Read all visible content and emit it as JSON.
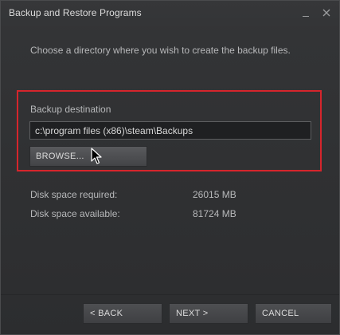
{
  "window": {
    "title": "Backup and Restore Programs"
  },
  "titlebar_buttons": {
    "minimize_icon": "minimize-icon",
    "close_icon": "close-icon"
  },
  "instruction": "Choose a directory where you wish to create the backup files.",
  "destination": {
    "label": "Backup destination",
    "value": "c:\\program files (x86)\\steam\\Backups",
    "browse_label": "BROWSE..."
  },
  "disk": {
    "required_label": "Disk space required:",
    "required_value": "26015 MB",
    "available_label": "Disk space available:",
    "available_value": "81724 MB"
  },
  "footer": {
    "back_label": "< BACK",
    "next_label": "NEXT >",
    "cancel_label": "CANCEL"
  },
  "colors": {
    "highlight": "#d6252c",
    "background": "#333436",
    "text": "#b7b8ba"
  }
}
